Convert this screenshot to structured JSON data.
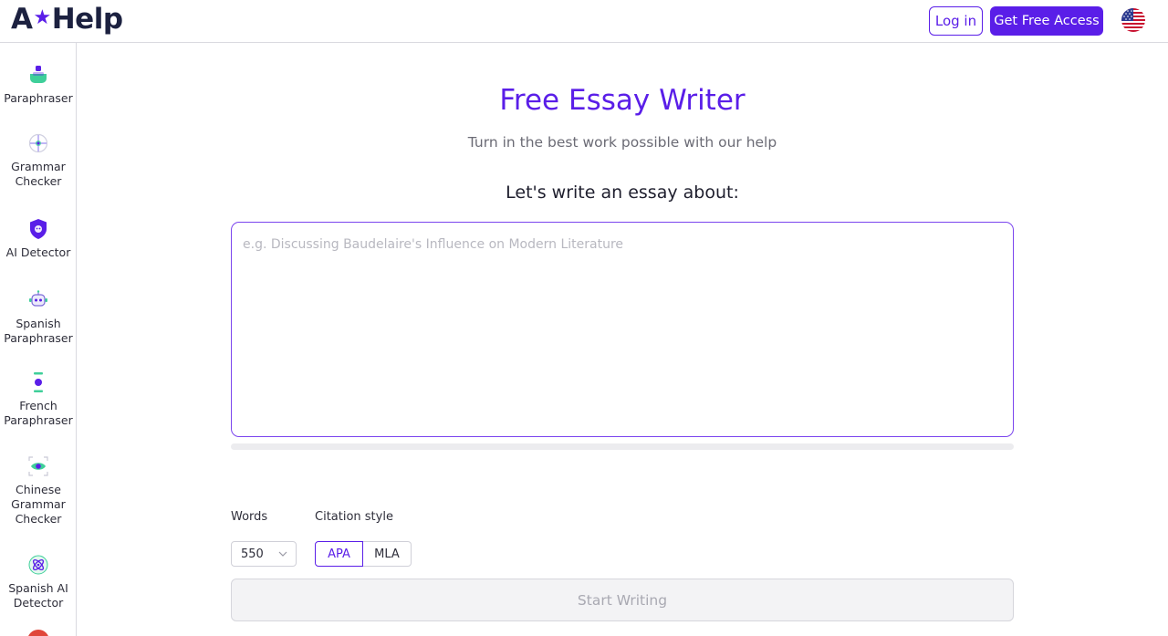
{
  "brand": {
    "logo_left": "A",
    "logo_star": "★",
    "logo_right": "Help"
  },
  "header": {
    "login_label": "Log in",
    "access_label": "Get Free Access",
    "language_icon": "us-flag-icon"
  },
  "sidebar": {
    "items": [
      {
        "label": "Paraphraser",
        "icon": "paraphraser-icon"
      },
      {
        "label": "Grammar Checker",
        "icon": "grammar-checker-icon"
      },
      {
        "label": "AI Detector",
        "icon": "ai-detector-shield-icon"
      },
      {
        "label": "Spanish Paraphraser",
        "icon": "robot-icon"
      },
      {
        "label": "French Paraphraser",
        "icon": "hourglass-icon"
      },
      {
        "label": "Chinese Grammar Checker",
        "icon": "eye-icon"
      },
      {
        "label": "Spanish AI Detector",
        "icon": "atom-icon"
      }
    ]
  },
  "main": {
    "title": "Free Essay Writer",
    "subtitle": "Turn in the best work possible with our help",
    "prompt": "Let's write an essay about:",
    "essay_placeholder": "e.g. Discussing Baudelaire's Influence on Modern Literature",
    "essay_value": "",
    "progress": 0,
    "words_label": "Words",
    "words_value": "550",
    "citation_label": "Citation style",
    "citation_options": [
      "APA",
      "MLA"
    ],
    "citation_selected": "APA",
    "start_label": "Start Writing"
  },
  "colors": {
    "accent": "#5a1ee8",
    "border": "#d9d9e0",
    "muted_text": "#6b6b75"
  }
}
